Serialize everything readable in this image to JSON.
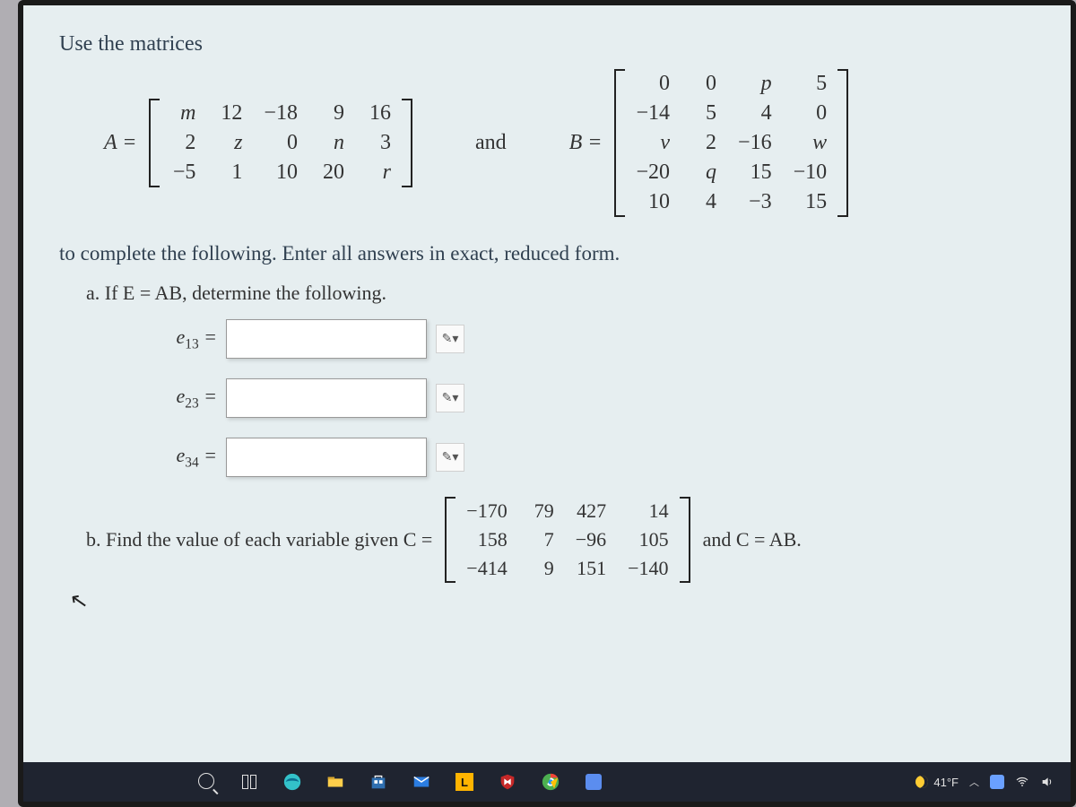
{
  "intro": "Use the matrices",
  "matrixA": {
    "label": "A =",
    "rows": [
      [
        "m",
        "12",
        "−18",
        "9",
        "16"
      ],
      [
        "2",
        "z",
        "0",
        "n",
        "3"
      ],
      [
        "−5",
        "1",
        "10",
        "20",
        "r"
      ]
    ]
  },
  "and": "and",
  "matrixB": {
    "label": "B =",
    "rows": [
      [
        "0",
        "0",
        "p",
        "5"
      ],
      [
        "−14",
        "5",
        "4",
        "0"
      ],
      [
        "v",
        "2",
        "−16",
        "w"
      ],
      [
        "−20",
        "q",
        "15",
        "−10"
      ],
      [
        "10",
        "4",
        "−3",
        "15"
      ]
    ]
  },
  "instruction": "to complete the following. Enter all answers in exact, reduced form.",
  "part_a": {
    "prompt": "a. If E = AB, determine the following.",
    "entries": [
      {
        "label_html": "e<sub>13</sub> ="
      },
      {
        "label_html": "e<sub>23</sub> ="
      },
      {
        "label_html": "e<sub>34</sub> ="
      }
    ]
  },
  "part_b": {
    "prefix": "b. Find the value of each variable given C =",
    "matrixC": {
      "rows": [
        [
          "−170",
          "79",
          "427",
          "14"
        ],
        [
          "158",
          "7",
          "−96",
          "105"
        ],
        [
          "−414",
          "9",
          "151",
          "−140"
        ]
      ]
    },
    "suffix": "and C = AB."
  },
  "taskbar": {
    "weather": "41°F"
  }
}
